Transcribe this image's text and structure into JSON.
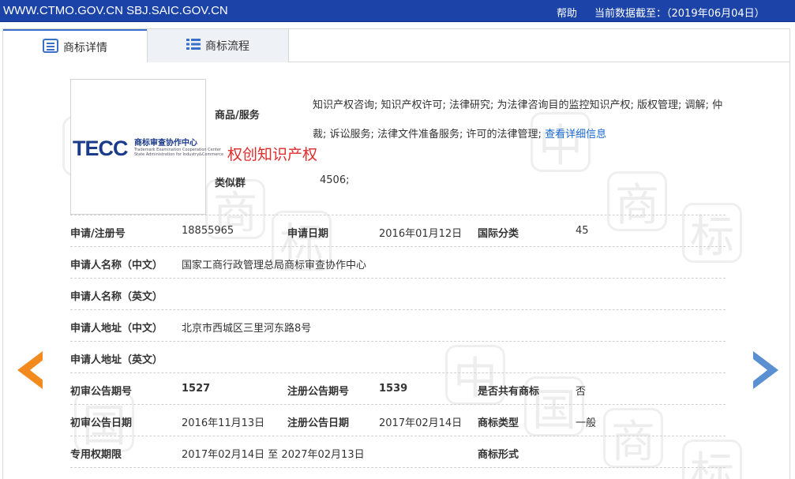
{
  "topbar": {
    "sites": "WWW.CTMO.GOV.CN SBJ.SAIC.GOV.CN",
    "help": "帮助",
    "as_of": "当前数据截至：（2019年06月04日）"
  },
  "tabs": [
    {
      "label": "商标详情",
      "icon": "list-icon"
    },
    {
      "label": "商标流程",
      "icon": "grid-list-icon"
    }
  ],
  "logo": {
    "mark": "TECC",
    "cn_name": "商标审查协作中心",
    "en_line1": "Trademark Examination Cooperation Center",
    "en_line2": "State Administration for Industry&Commerce"
  },
  "overlay_text": "权创知识产权",
  "goods": {
    "label": "商品/服务",
    "text": "知识产权咨询; 知识产权许可; 法律研究; 为法律咨询目的监控知识产权; 版权管理; 调解; 仲裁; 诉讼服务; 法律文件准备服务; 许可的法律管理; ",
    "link": "查看详细信息"
  },
  "similar_group": {
    "label": "类似群",
    "value": "4506;"
  },
  "fields": {
    "reg_no": {
      "label": "申请/注册号",
      "value": "18855965"
    },
    "app_date": {
      "label": "申请日期",
      "value": "2016年01月12日"
    },
    "intl_class": {
      "label": "国际分类",
      "value": "45"
    },
    "applicant_cn": {
      "label": "申请人名称（中文）",
      "value": "国家工商行政管理总局商标审查协作中心"
    },
    "applicant_en": {
      "label": "申请人名称（英文）",
      "value": ""
    },
    "address_cn": {
      "label": "申请人地址（中文）",
      "value": "北京市西城区三里河东路8号"
    },
    "address_en": {
      "label": "申请人地址（英文）",
      "value": ""
    },
    "prelim_no": {
      "label": "初审公告期号",
      "value": "1527"
    },
    "reg_pub_no": {
      "label": "注册公告期号",
      "value": "1539"
    },
    "shared": {
      "label": "是否共有商标",
      "value": "否"
    },
    "prelim_date": {
      "label": "初审公告日期",
      "value": "2016年11月13日"
    },
    "reg_pub_date": {
      "label": "注册公告日期",
      "value": "2017年02月14日"
    },
    "tm_type": {
      "label": "商标类型",
      "value": "一般"
    },
    "exclusive_period": {
      "label": "专用权期限",
      "value": "2017年02月14日 至 2027年02月13日"
    },
    "tm_form": {
      "label": "商标形式",
      "value": ""
    }
  },
  "watermark_char": [
    "中",
    "国",
    "商",
    "标"
  ]
}
